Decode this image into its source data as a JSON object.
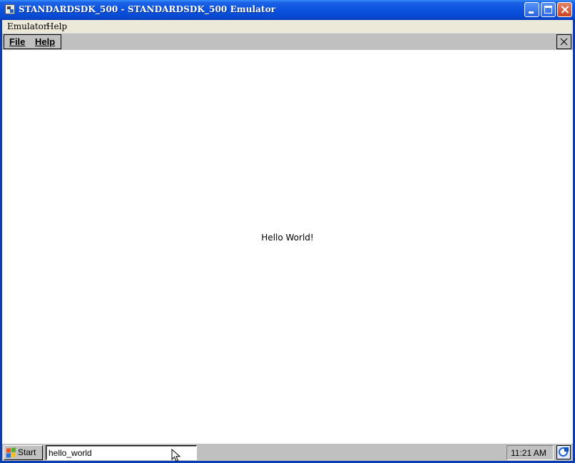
{
  "window": {
    "title": "STANDARDSDK_500 - STANDARDSDK_500 Emulator"
  },
  "host_menu": {
    "items": [
      {
        "label": "Emulator"
      },
      {
        "label": "Help"
      }
    ]
  },
  "device_menu": {
    "items": [
      {
        "label": "File"
      },
      {
        "label": "Help"
      }
    ],
    "close_glyph": "×"
  },
  "content": {
    "message": "Hello World!"
  },
  "taskbar": {
    "start_label": "Start",
    "task_label": "hello_world",
    "clock": "11:21 AM"
  },
  "colors": {
    "title_blue": "#0a53df",
    "device_gray": "#c0c0c0",
    "client_beige": "#ece9d8"
  },
  "icons": [
    "app-window-icon",
    "minimize-icon",
    "maximize-icon",
    "close-icon",
    "windows-flag-icon",
    "desktop-icon",
    "mouse-cursor-icon"
  ]
}
